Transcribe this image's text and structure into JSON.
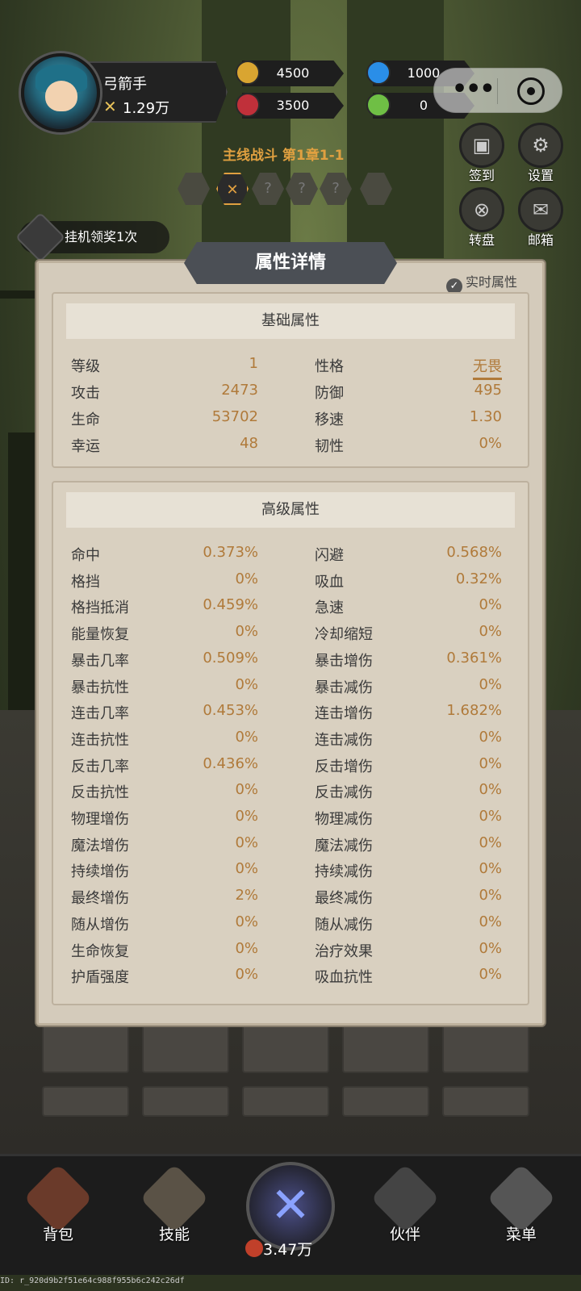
{
  "hero": {
    "name": "弓箭手",
    "power": "1.29万"
  },
  "resources": {
    "gold": "4500",
    "gem": "3500",
    "blue": "1000",
    "ticket": "0"
  },
  "stage": {
    "title": "主线战斗 第1章1-1",
    "nodes": [
      "",
      "✕",
      "?",
      "?",
      "?",
      ""
    ]
  },
  "side_buttons": [
    {
      "label": "签到"
    },
    {
      "label": "设置"
    },
    {
      "label": "转盘"
    },
    {
      "label": "邮箱"
    }
  ],
  "idle_reward": "挂机领奖1次",
  "modal": {
    "title": "属性详情",
    "realtime_label": "实时属性",
    "basic": {
      "header": "基础属性",
      "rows": [
        {
          "k": "等级",
          "v": "1",
          "k2": "性格",
          "v2": "无畏"
        },
        {
          "k": "攻击",
          "v": "2473",
          "k2": "防御",
          "v2": "495"
        },
        {
          "k": "生命",
          "v": "53702",
          "k2": "移速",
          "v2": "1.30"
        },
        {
          "k": "幸运",
          "v": "48",
          "k2": "韧性",
          "v2": "0%"
        }
      ]
    },
    "advanced": {
      "header": "高级属性",
      "rows": [
        {
          "k": "命中",
          "v": "0.373%",
          "k2": "闪避",
          "v2": "0.568%"
        },
        {
          "k": "格挡",
          "v": "0%",
          "k2": "吸血",
          "v2": "0.32%"
        },
        {
          "k": "格挡抵消",
          "v": "0.459%",
          "k2": "急速",
          "v2": "0%"
        },
        {
          "k": "能量恢复",
          "v": "0%",
          "k2": "冷却缩短",
          "v2": "0%"
        },
        {
          "k": "暴击几率",
          "v": "0.509%",
          "k2": "暴击增伤",
          "v2": "0.361%"
        },
        {
          "k": "暴击抗性",
          "v": "0%",
          "k2": "暴击减伤",
          "v2": "0%"
        },
        {
          "k": "连击几率",
          "v": "0.453%",
          "k2": "连击增伤",
          "v2": "1.682%"
        },
        {
          "k": "连击抗性",
          "v": "0%",
          "k2": "连击减伤",
          "v2": "0%"
        },
        {
          "k": "反击几率",
          "v": "0.436%",
          "k2": "反击增伤",
          "v2": "0%"
        },
        {
          "k": "反击抗性",
          "v": "0%",
          "k2": "反击减伤",
          "v2": "0%"
        },
        {
          "k": "物理增伤",
          "v": "0%",
          "k2": "物理减伤",
          "v2": "0%"
        },
        {
          "k": "魔法增伤",
          "v": "0%",
          "k2": "魔法减伤",
          "v2": "0%"
        },
        {
          "k": "持续增伤",
          "v": "0%",
          "k2": "持续减伤",
          "v2": "0%"
        },
        {
          "k": "最终增伤",
          "v": "2%",
          "k2": "最终减伤",
          "v2": "0%"
        },
        {
          "k": "随从增伤",
          "v": "0%",
          "k2": "随从减伤",
          "v2": "0%"
        },
        {
          "k": "生命恢复",
          "v": "0%",
          "k2": "治疗效果",
          "v2": "0%"
        },
        {
          "k": "护盾强度",
          "v": "0%",
          "k2": "吸血抗性",
          "v2": "0%"
        }
      ]
    }
  },
  "bottom_nav": {
    "bag": "背包",
    "skill": "技能",
    "battle_power": "3.47万",
    "partner": "伙伴",
    "menu": "菜单"
  },
  "footer_id": "ID: r_920d9b2f51e64c988f955b6c242c26df",
  "colors": {
    "value": "#b07a3a",
    "stage_title": "#e0a040",
    "modal_bg": "#d4cbbb"
  }
}
